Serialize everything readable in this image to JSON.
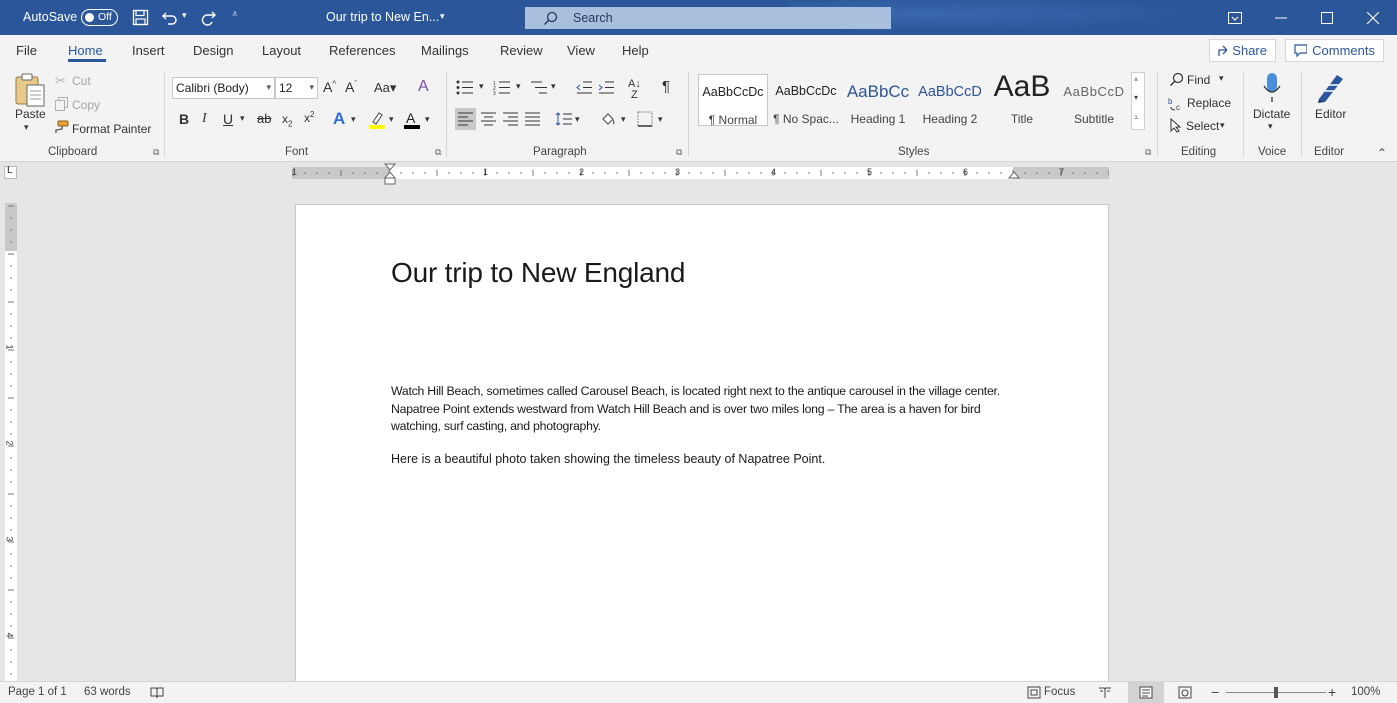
{
  "titlebar": {
    "autosave_label": "AutoSave",
    "autosave_state": "Off",
    "doc_name": "Our trip to New En...",
    "search_placeholder": "Search"
  },
  "menu": {
    "tabs": [
      "File",
      "Home",
      "Insert",
      "Design",
      "Layout",
      "References",
      "Mailings",
      "Review",
      "View",
      "Help"
    ],
    "active_tab": "Home",
    "share_label": "Share",
    "comments_label": "Comments"
  },
  "ribbon": {
    "clipboard": {
      "paste": "Paste",
      "cut": "Cut",
      "copy": "Copy",
      "format_painter": "Format Painter",
      "label": "Clipboard"
    },
    "font": {
      "name": "Calibri (Body)",
      "size": "12",
      "label": "Font"
    },
    "paragraph": {
      "label": "Paragraph"
    },
    "styles": {
      "items": [
        {
          "sample": "AaBbCcDc",
          "name": "¶ Normal"
        },
        {
          "sample": "AaBbCcDc",
          "name": "¶ No Spac..."
        },
        {
          "sample": "AaBbCc",
          "name": "Heading 1"
        },
        {
          "sample": "AaBbCcD",
          "name": "Heading 2"
        },
        {
          "sample": "AaB",
          "name": "Title"
        },
        {
          "sample": "AaBbCcD",
          "name": "Subtitle"
        }
      ],
      "label": "Styles"
    },
    "editing": {
      "find": "Find",
      "replace": "Replace",
      "select": "Select",
      "label": "Editing"
    },
    "voice": {
      "dictate": "Dictate",
      "label": "Voice"
    },
    "editor": {
      "editor": "Editor",
      "label": "Editor"
    }
  },
  "ruler": {
    "h_numbers": [
      "1",
      "1",
      "2",
      "3",
      "4",
      "5",
      "6",
      "7"
    ],
    "v_numbers": [
      "1",
      "2",
      "3",
      "4"
    ]
  },
  "document": {
    "title": "Our trip to New England",
    "paragraph1": "Watch Hill Beach, sometimes called Carousel Beach, is located right next to the antique carousel in the village center. Napatree Point extends westward from Watch Hill Beach and is over two miles long – The area is a haven for bird watching, surf casting, and photography.",
    "paragraph2": "Here is a beautiful photo taken showing the timeless beauty of Napatree Point."
  },
  "status": {
    "page": "Page 1 of 1",
    "words": "63 words",
    "focus": "Focus",
    "zoom": "100%",
    "zoom_level": 0.5
  },
  "colors": {
    "brand": "#2b579a",
    "highlight": "#ffff00",
    "font_color": "#000000"
  }
}
